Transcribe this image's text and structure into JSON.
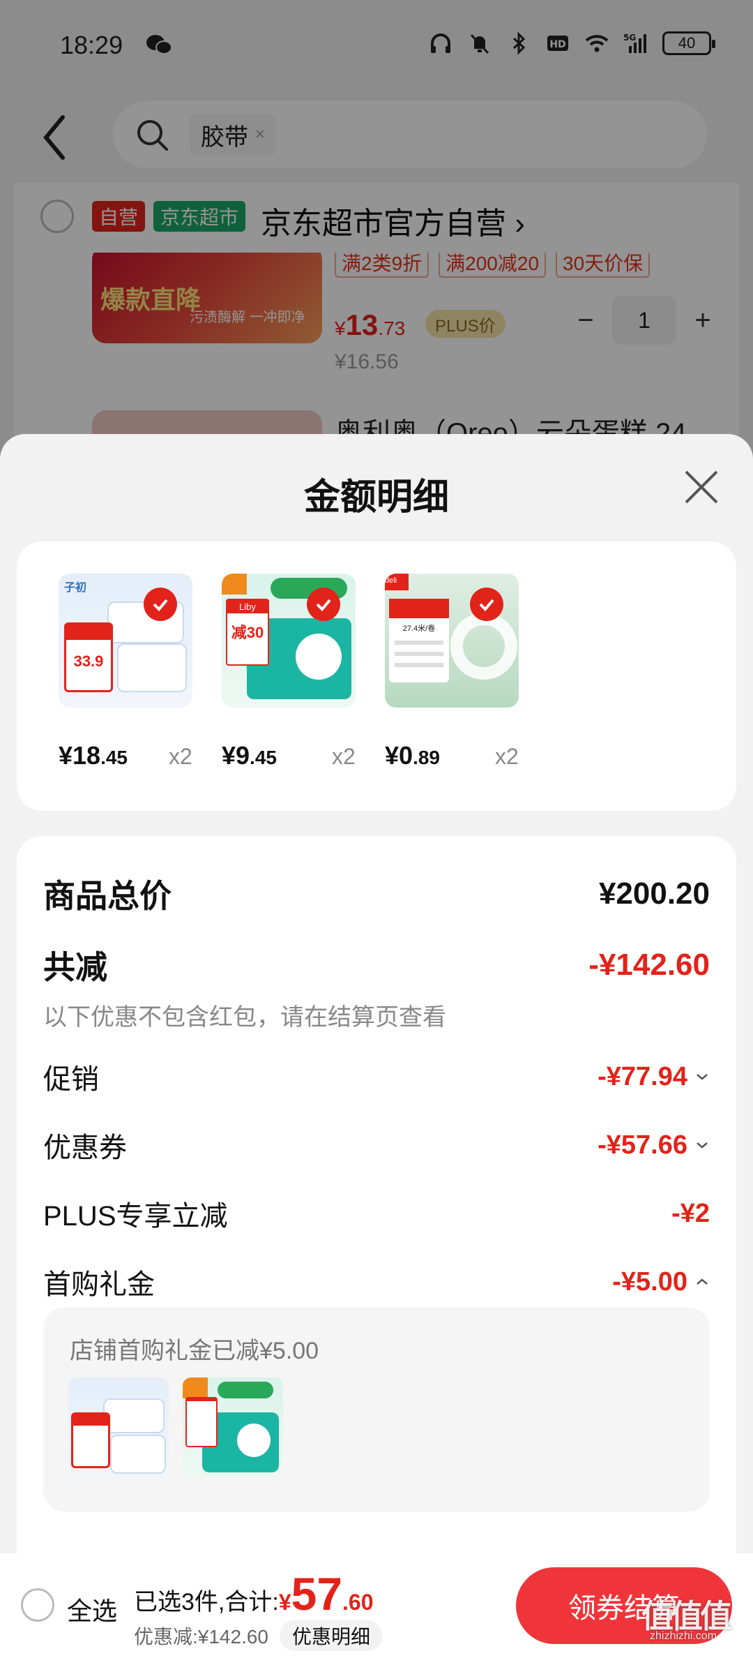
{
  "status_bar": {
    "time": "18:29",
    "battery": "40",
    "icons": [
      "wechat-icon",
      "headphones-icon",
      "mute-icon",
      "bluetooth-icon",
      "hd-icon",
      "wifi-icon",
      "5g-signal-icon",
      "battery-icon"
    ]
  },
  "search": {
    "query": "胶带",
    "clear": "×"
  },
  "shop": {
    "tag_self": "自营",
    "tag_market": "京东超市",
    "name": "京东超市官方自营 ›"
  },
  "cart_item": {
    "image_text_1": "爆款直降",
    "image_text_2": "污渍酶解 一冲即净",
    "promo_tags": [
      "满2类9折",
      "满200减20",
      "30天价保"
    ],
    "price_yen": "¥",
    "price_int": "13",
    "price_dec": ".73",
    "plus_tag": "PLUS价",
    "original_price": "¥16.56",
    "quantity": "1",
    "minus": "−",
    "plus": "+",
    "next_title": "奥利奥（Oreo）云朵蛋糕 24"
  },
  "sheet": {
    "title": "金额明细",
    "goods": [
      {
        "price_int": "¥18",
        "price_dec": ".45",
        "qty": "x2",
        "thumb_price": "33.9",
        "thumb_brand": "子初"
      },
      {
        "price_int": "¥9",
        "price_dec": ".45",
        "qty": "x2",
        "thumb_price": "减30",
        "thumb_brand": "Liby"
      },
      {
        "price_int": "¥0",
        "price_dec": ".89",
        "qty": "x2",
        "thumb_price": "27.4米/卷",
        "thumb_brand": "deli"
      }
    ],
    "total_label": "商品总价",
    "total_value": "¥200.20",
    "reduce_label": "共减",
    "reduce_value": "-¥142.60",
    "reduce_note": "以下优惠不包含红包，请在结算页查看",
    "rows": [
      {
        "label": "促销",
        "value": "-¥77.94"
      },
      {
        "label": "优惠券",
        "value": "-¥57.66"
      },
      {
        "label": "PLUS专享立减",
        "value": "-¥2"
      },
      {
        "label": "首购礼金",
        "value": "-¥5.00"
      }
    ],
    "gift_text": "店铺首购礼金已减¥5.00"
  },
  "bottom": {
    "select_all": "全选",
    "selected_prefix": "已选3件,合计:",
    "yen": "¥",
    "total_int": "57",
    "total_dec": ".60",
    "discount_text": "优惠减:¥142.60",
    "detail_chip": "优惠明细",
    "checkout": "领券结算"
  },
  "watermark": {
    "main": "值值值",
    "sub": "zhizhizhi.com"
  },
  "colors": {
    "accent_red": "#e2231a",
    "checkout_red": "#f0353a",
    "market_green": "#1aa866"
  }
}
